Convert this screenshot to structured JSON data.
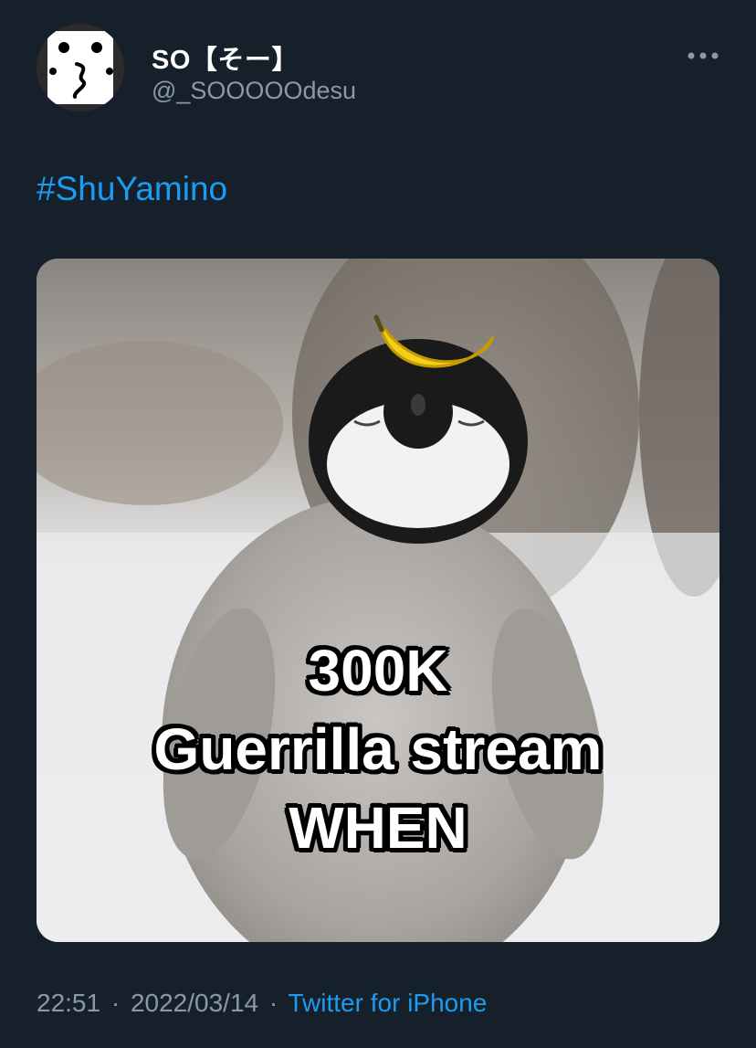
{
  "author": {
    "display_name": "SO【そー】",
    "handle": "@_SOOOOOdesu"
  },
  "tweet": {
    "hashtag": "#ShuYamino",
    "media": {
      "caption_lines": [
        "300K",
        "Guerrilla stream",
        "WHEN"
      ]
    },
    "time": "22:51",
    "date": "2022/03/14",
    "separator": "·",
    "source": "Twitter for iPhone"
  },
  "icons": {
    "more": "more-options-icon",
    "avatar": "avatar-face-icon"
  },
  "colors": {
    "background": "#15202b",
    "link": "#1d9bf0",
    "secondary_text": "#8b98a5"
  }
}
